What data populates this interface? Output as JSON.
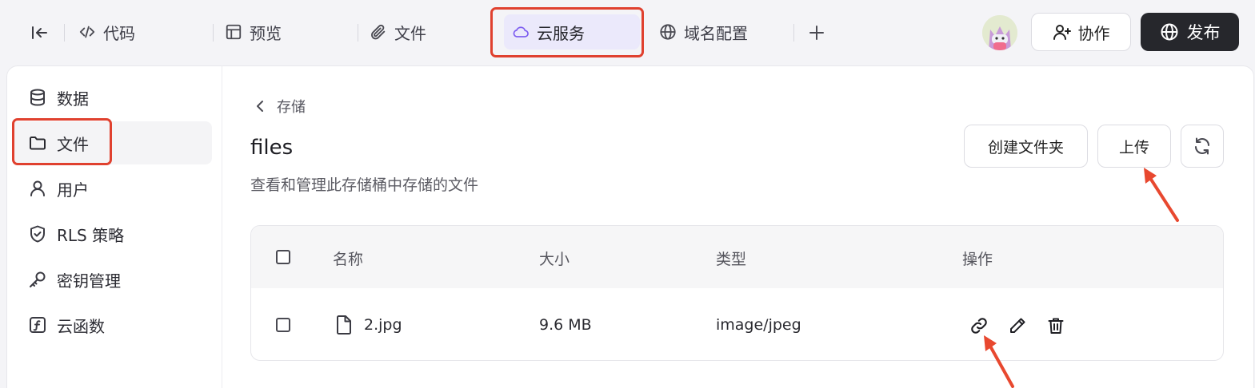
{
  "topbar": {
    "tabs": [
      {
        "label": "代码",
        "icon": "code-icon"
      },
      {
        "label": "预览",
        "icon": "layout-icon"
      },
      {
        "label": "文件",
        "icon": "paperclip-icon"
      },
      {
        "label": "云服务",
        "icon": "cloud-icon"
      },
      {
        "label": "域名配置",
        "icon": "globe-icon"
      }
    ],
    "active_tab": "云服务",
    "collab_label": "协作",
    "publish_label": "发布"
  },
  "sidebar": {
    "items": [
      {
        "label": "数据",
        "icon": "database-icon"
      },
      {
        "label": "文件",
        "icon": "folder-icon"
      },
      {
        "label": "用户",
        "icon": "user-icon"
      },
      {
        "label": "RLS 策略",
        "icon": "shield-icon"
      },
      {
        "label": "密钥管理",
        "icon": "key-icon"
      },
      {
        "label": "云函数",
        "icon": "function-icon"
      }
    ],
    "active_item": "文件"
  },
  "main": {
    "back_label": "存储",
    "title": "files",
    "subtitle": "查看和管理此存储桶中存储的文件",
    "create_folder_label": "创建文件夹",
    "upload_label": "上传",
    "table": {
      "headers": {
        "name": "名称",
        "size": "大小",
        "type": "类型",
        "actions": "操作"
      },
      "rows": [
        {
          "name": "2.jpg",
          "size": "9.6 MB",
          "type": "image/jpeg"
        }
      ]
    }
  },
  "colors": {
    "accent": "#7c5cf0",
    "highlight": "#e0412f",
    "publish_bg": "#26272c",
    "active_tab_bg": "#ebe9fb"
  }
}
